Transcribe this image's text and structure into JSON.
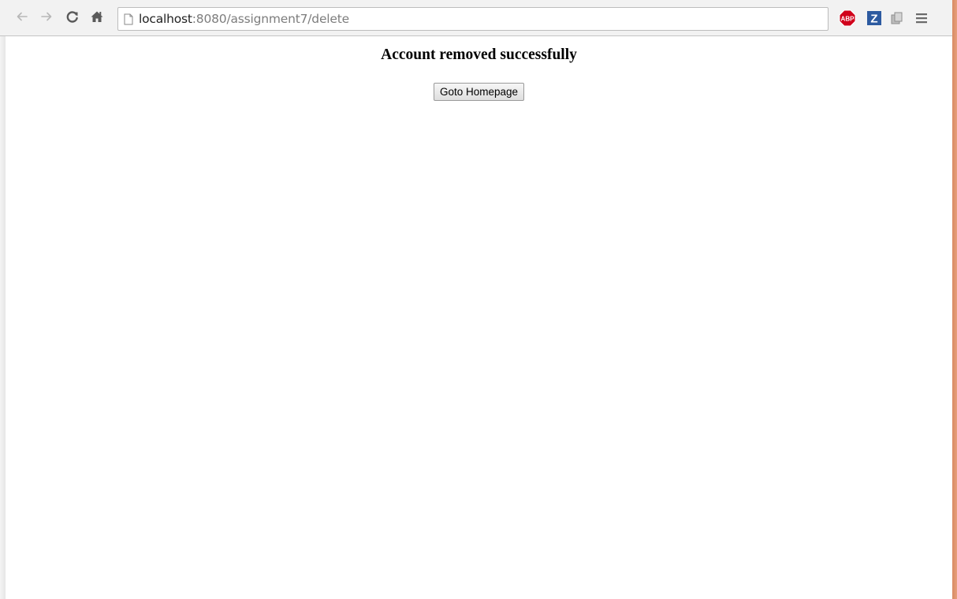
{
  "browser": {
    "url_host": "localhost",
    "url_rest": ":8080/assignment7/delete",
    "nav_icons": [
      "back-arrow-icon",
      "forward-arrow-icon",
      "reload-icon",
      "home-icon"
    ],
    "extensions": [
      {
        "name": "adblock-plus-icon",
        "label": "ABP",
        "color": "#d0021b"
      },
      {
        "name": "zotero-icon",
        "label": "Z",
        "color": "#2c5aa0"
      },
      {
        "name": "extension-icon",
        "label": "",
        "color": "#9a9a9a"
      },
      {
        "name": "menu-icon",
        "label": "",
        "color": "#6a6a6a"
      }
    ]
  },
  "page": {
    "heading": "Account removed successfully",
    "button_label": "Goto Homepage"
  },
  "colors": {
    "window_edge": "#e09470",
    "toolbar_bg": "#f2f2f2",
    "url_dim": "#7d7d7d"
  }
}
